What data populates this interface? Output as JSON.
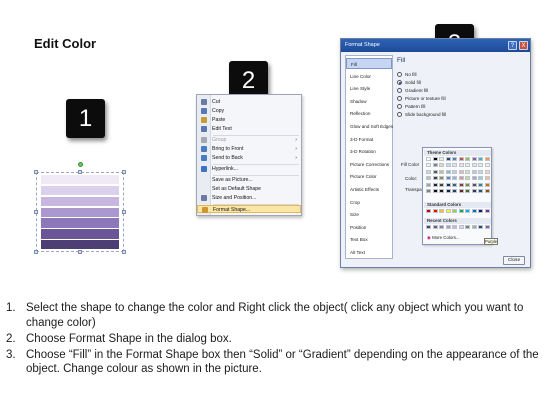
{
  "slide": {
    "title": "Edit Color"
  },
  "badges": [
    "1",
    "2",
    "3"
  ],
  "shape": {
    "band_colors": [
      "#efeaf6",
      "#dcd1ec",
      "#c6b6e0",
      "#ab98cf",
      "#8c77b8",
      "#6a5697",
      "#4d3e74"
    ],
    "stroke_color": "#ffffff"
  },
  "context_menu": {
    "items": [
      {
        "label": "Cut",
        "icon": "scissors-icon",
        "state": "enabled"
      },
      {
        "label": "Copy",
        "icon": "copy-icon",
        "state": "enabled"
      },
      {
        "label": "Paste",
        "icon": "paste-icon",
        "state": "enabled"
      },
      {
        "label": "Edit Text",
        "icon": "edit-text-icon",
        "state": "enabled"
      },
      {
        "label": "Group",
        "icon": "group-icon",
        "state": "disabled",
        "submenu": true
      },
      {
        "label": "Bring to Front",
        "icon": "bring-front-icon",
        "state": "enabled",
        "submenu": true
      },
      {
        "label": "Send to Back",
        "icon": "send-back-icon",
        "state": "enabled",
        "submenu": true
      },
      {
        "label": "Hyperlink...",
        "icon": "hyperlink-icon",
        "state": "enabled"
      },
      {
        "label": "Save as Picture...",
        "icon": "",
        "state": "enabled"
      },
      {
        "label": "Set as Default Shape",
        "icon": "",
        "state": "enabled"
      },
      {
        "label": "Size and Position...",
        "icon": "size-position-icon",
        "state": "enabled"
      },
      {
        "label": "Format Shape...",
        "icon": "format-shape-icon",
        "state": "highlighted"
      }
    ]
  },
  "dialog": {
    "title": "Format Shape",
    "help": "?",
    "close": "X",
    "nav": [
      "Fill",
      "Line Color",
      "Line Style",
      "Shadow",
      "Reflection",
      "Glow and Soft Edges",
      "3-D Format",
      "3-D Rotation",
      "Picture Corrections",
      "Picture Color",
      "Artistic Effects",
      "Crop",
      "Size",
      "Position",
      "Text Box",
      "Alt Text"
    ],
    "selected_nav": "Fill",
    "fill_heading": "Fill",
    "radios": [
      {
        "label": "No fill",
        "on": false
      },
      {
        "label": "Solid fill",
        "on": true
      },
      {
        "label": "Gradient fill",
        "on": false
      },
      {
        "label": "Picture or texture fill",
        "on": false
      },
      {
        "label": "Pattern fill",
        "on": false
      },
      {
        "label": "Slide background fill",
        "on": false
      }
    ],
    "fill_color_label": "Fill Color",
    "color_label": "Color:",
    "transparency_label": "Transpa",
    "close_button": "Close"
  },
  "palette": {
    "theme_label": "Theme Colors",
    "standard_label": "Standard Colors",
    "recent_label": "Recent Colors",
    "more_label": "More Colors...",
    "tooltip": "Purple",
    "theme_top": [
      "#ffffff",
      "#000000",
      "#eeece1",
      "#1f497d",
      "#4f81bd",
      "#c0504d",
      "#9bbb59",
      "#8064a2",
      "#4bacc6",
      "#f79646"
    ],
    "theme_shades": [
      [
        "#f2f2f2",
        "#7f7f7f",
        "#ddd9c3",
        "#c6d9f0",
        "#dbe5f1",
        "#f2dcdb",
        "#ebf1dd",
        "#e5e0ec",
        "#dbeef3",
        "#fdeada"
      ],
      [
        "#d8d8d8",
        "#595959",
        "#c4bd97",
        "#8db3e2",
        "#b8cce4",
        "#e5b9b7",
        "#d7e3bc",
        "#ccc1d9",
        "#b7dde8",
        "#fbd5b5"
      ],
      [
        "#bfbfbf",
        "#3f3f3f",
        "#938953",
        "#548dd4",
        "#95b3d7",
        "#d99694",
        "#c3d69b",
        "#b2a2c7",
        "#92cddc",
        "#fac08f"
      ],
      [
        "#a5a5a5",
        "#262626",
        "#494429",
        "#17365d",
        "#366092",
        "#953734",
        "#76923c",
        "#5f497a",
        "#31859b",
        "#e36c09"
      ],
      [
        "#7f7f7f",
        "#0c0c0c",
        "#1d1b10",
        "#0f243e",
        "#244061",
        "#632423",
        "#4f6128",
        "#3f3151",
        "#205867",
        "#974806"
      ]
    ],
    "standard": [
      "#c00000",
      "#ff0000",
      "#ffc000",
      "#ffff00",
      "#92d050",
      "#00b050",
      "#00b0f0",
      "#0070c0",
      "#002060",
      "#7030a0"
    ],
    "recent": [
      "#4d3e74",
      "#6a5697",
      "#8c77b8",
      "#ab98cf",
      "#c6b6e0",
      "#dcd1ec",
      "#7f7f7f",
      "#a5a5a5",
      "#1f497d",
      "#8064a2"
    ]
  },
  "instructions": [
    {
      "num": "1.",
      "text": "Select the shape to change the color and Right click the object( click any object which you want to change color)"
    },
    {
      "num": "2.",
      "text": "Choose Format Shape in the dialog box."
    },
    {
      "num": "3.",
      "text": "Choose “Fill” in the Format Shape box then “Solid” or “Gradient” depending on the appearance of the object. Change colour as shown in the picture."
    }
  ]
}
